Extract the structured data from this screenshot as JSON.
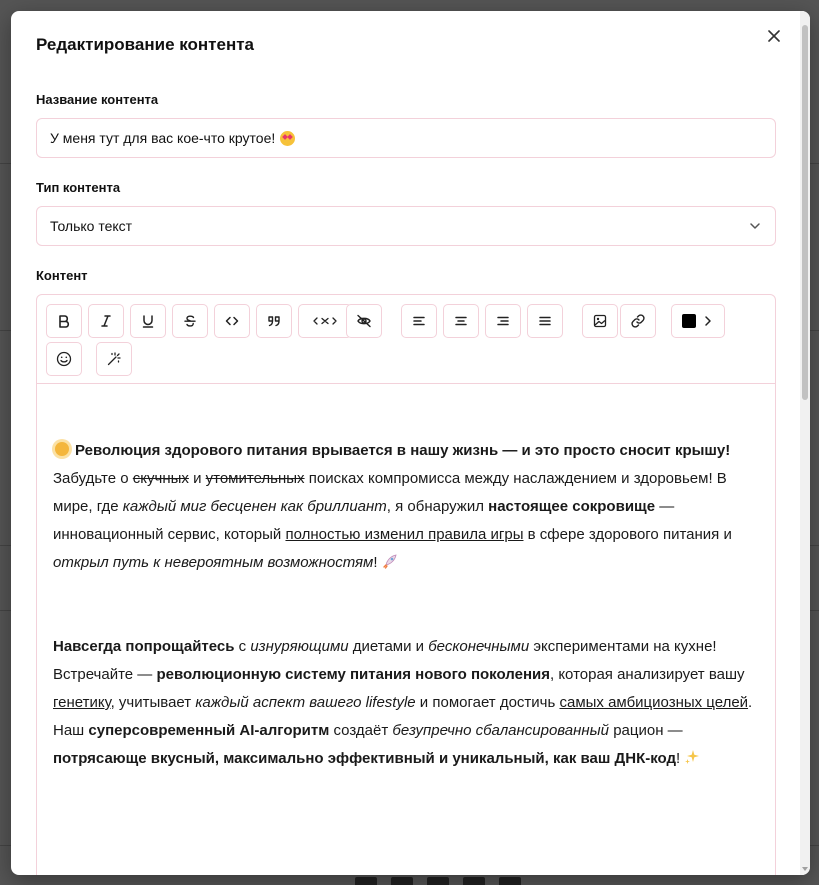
{
  "modal": {
    "title": "Редактирование контента"
  },
  "fields": {
    "name_label": "Название контента",
    "name_value": "У меня тут для вас кое-что крутое!",
    "type_label": "Тип контента",
    "type_value": "Только текст",
    "content_label": "Контент"
  },
  "toolbar": {
    "buttons": [
      "bold",
      "italic",
      "underline",
      "strikethrough",
      "code",
      "quote",
      "variable",
      "hide",
      "align-left",
      "align-center",
      "align-right",
      "justify",
      "image",
      "link",
      "text-color",
      "emoji",
      "magic"
    ],
    "text_color": "#000000"
  },
  "content": {
    "p1": {
      "headline": "Революция здорового питания врывается в нашу жизнь — и это просто сносит крышу!",
      "t1": "Забудьте о ",
      "s1": "скучных",
      "t2": " и ",
      "s2": "утомительных",
      "t3": " поисках компромисса между наслаждением и здоровьем! В мире, где ",
      "i1": "каждый миг бесценен как бриллиант",
      "t4": ", я обнаружил ",
      "b1": "настоящее сокровище",
      "t5": " — инновационный сервис, который ",
      "u1": "полностью изменил правила игры",
      "t6": " в сфере здорового питания и ",
      "i2": "открыл путь к невероятным возможностям",
      "t7": "!"
    },
    "p2": {
      "b1": "Навсегда попрощайтесь",
      "t1": " с ",
      "i1": "изнуряющими",
      "t2": " диетами и ",
      "i2": "бесконечными",
      "t3": " экспериментами на кухне! Встречайте — ",
      "b2": "революционную систему питания нового поколения",
      "t4": ", которая анализирует вашу ",
      "u1": "генетику",
      "t5": ", учитывает ",
      "i3": "каждый аспект вашего lifestyle",
      "t6": " и помогает достичь ",
      "u2": "самых амбициозных целей",
      "t7": ". Наш ",
      "b3": "суперсовременный AI-алгоритм",
      "t8": " создаёт ",
      "i4": "безупречно сбалансированный",
      "t9": " рацион — ",
      "b4": "потрясающе вкусный, максимально эффективный и уникальный, как ваш ДНК-код",
      "t10": "!"
    }
  },
  "colors": {
    "border": "#f3d1da",
    "backdrop": "#555555"
  }
}
